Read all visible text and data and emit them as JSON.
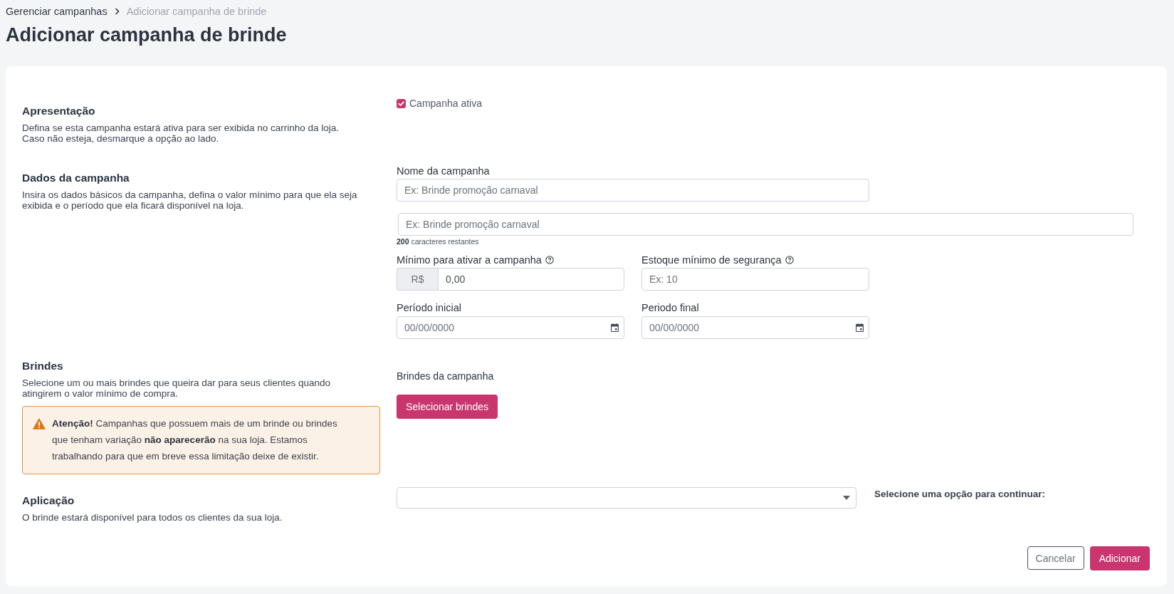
{
  "breadcrumb": [
    {
      "label": "Gerenciar campanhas",
      "current": false
    },
    {
      "label": "Adicionar campanha de brinde",
      "current": true
    }
  ],
  "title": "Adicionar campanha de brinde",
  "presentation": {
    "heading": "Apresentação",
    "description": "Defina se esta campanha estará ativa para ser exibida no carrinho da loja. Caso não esteja, desmarque a opção ao lado.",
    "checkbox": {
      "label": "Campanha ativa",
      "checked": true
    }
  },
  "campaign_data": {
    "heading": "Dados da campanha",
    "description": "Insira os dados básicos da campanha, defina o valor mínimo para que ela seja exibida e o período que ela ficará disponível na loja.",
    "name_field": {
      "label": "Nome da campanha",
      "placeholder": "Ex: Brinde promoção carnaval"
    },
    "text_field": {
      "placeholder": "Ex: Brinde promoção carnaval",
      "counter": "**200** caracteres restantes"
    },
    "minimum_field": {
      "label": "Mínimo para ativar a campanha",
      "prefix": "R$",
      "value": "0,00"
    },
    "stock_field": {
      "label": "Estoque mínimo de segurança",
      "placeholder": "Ex: 10"
    },
    "start_date": {
      "label": "Período inicial",
      "placeholder": "00/00/0000"
    },
    "end_date": {
      "label": "Periodo final",
      "placeholder": "00/00/0000"
    }
  },
  "gifts": {
    "heading": "Brindes",
    "description": "Selecione um ou mais brindes que queira dar para seus clientes quando atingirem o valor mínimo de compra.",
    "warning": "**Atenção!** Campanhas que possuem mais de um brinde ou brindes que tenham variação **não aparecerão** na sua loja. Estamos trabalhando para que em breve essa limitação deixe de existir.",
    "list_label": "Brindes da campanha",
    "button": "Selecionar brindes"
  },
  "application": {
    "heading": "Aplicação",
    "description": "O brinde estará disponível para todos os clientes da sua loja.",
    "hint": "Selecione uma opção para continuar:"
  },
  "actions": [
    {
      "label": "Cancelar",
      "kind": "secondary"
    },
    {
      "label": "Adicionar",
      "kind": "primary"
    }
  ]
}
